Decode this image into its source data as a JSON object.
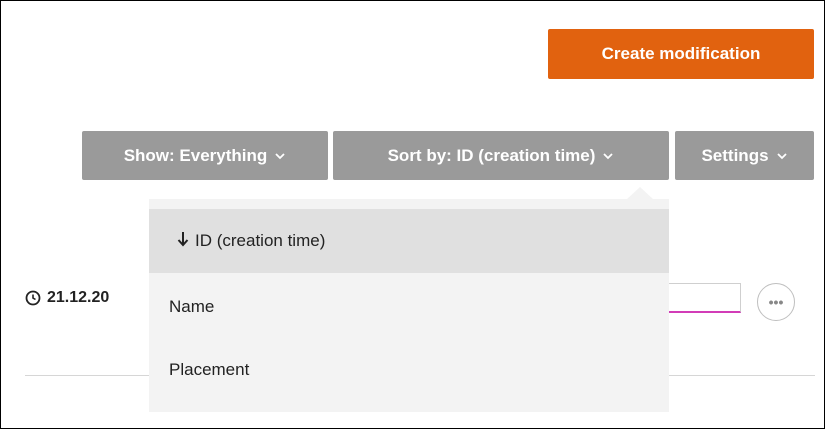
{
  "header": {
    "create_label": "Create modification"
  },
  "toolbar": {
    "show_label": "Show: Everything",
    "sort_label": "Sort by: ID (creation time)",
    "settings_label": "Settings"
  },
  "sort_menu": {
    "items": [
      {
        "label": "ID (creation time)",
        "selected": true,
        "direction_icon": "arrow-down-icon"
      },
      {
        "label": "Name",
        "selected": false
      },
      {
        "label": "Placement",
        "selected": false
      }
    ]
  },
  "row": {
    "date_text": "21.12.20",
    "more_glyph": "•••"
  },
  "colors": {
    "accent": "#e1620f",
    "toolbar_bg": "#9a9a9a",
    "menu_bg": "#f3f3f3",
    "menu_selected_bg": "#e0e0e0",
    "focus_underline": "#d23cb7"
  }
}
